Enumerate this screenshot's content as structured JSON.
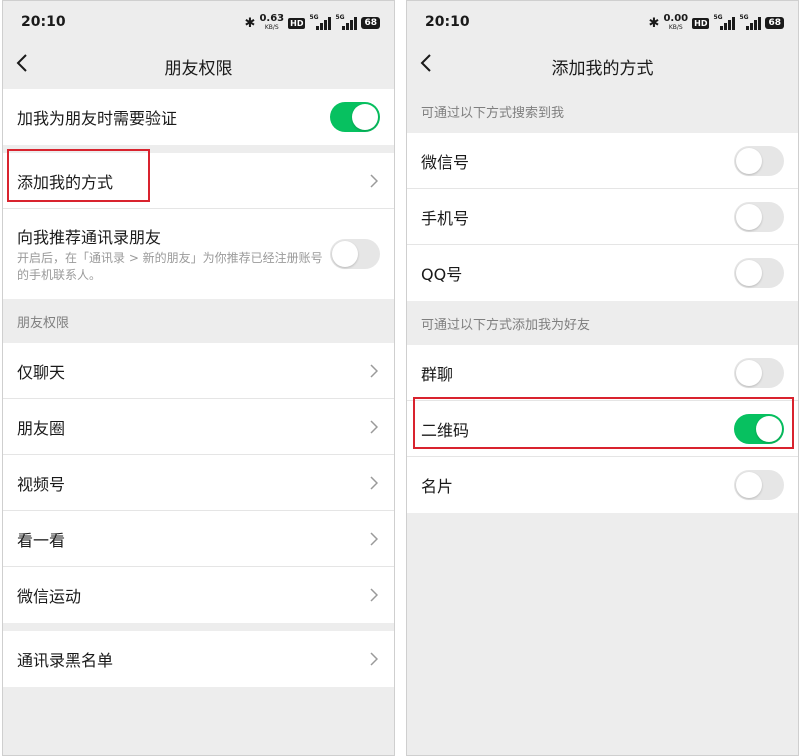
{
  "status": {
    "time": "20:10",
    "left_speed": "0.63",
    "right_speed": "0.00",
    "speed_unit": "KB/S",
    "hd": "HD",
    "net": "5G",
    "battery": "68"
  },
  "left": {
    "title": "朋友权限",
    "verify": {
      "label": "加我为朋友时需要验证",
      "on": true
    },
    "add_ways": "添加我的方式",
    "recommend": {
      "label": "向我推荐通讯录朋友",
      "desc": "开启后，在「通讯录 > 新的朋友」为你推荐已经注册账号的手机联系人。"
    },
    "section_friends": "朋友权限",
    "friend_items": [
      {
        "label": "仅聊天"
      },
      {
        "label": "朋友圈"
      },
      {
        "label": "视频号"
      },
      {
        "label": "看一看"
      },
      {
        "label": "微信运动"
      }
    ],
    "blacklist": "通讯录黑名单"
  },
  "right": {
    "title": "添加我的方式",
    "section_search": "可通过以下方式搜索到我",
    "search_items": [
      {
        "label": "微信号",
        "on": false
      },
      {
        "label": "手机号",
        "on": false
      },
      {
        "label": "QQ号",
        "on": false
      }
    ],
    "section_add": "可通过以下方式添加我为好友",
    "add_items": [
      {
        "label": "群聊",
        "on": false
      },
      {
        "label": "二维码",
        "on": true
      },
      {
        "label": "名片",
        "on": false
      }
    ]
  },
  "colors": {
    "accent_green": "#07c160",
    "highlight_red": "#d9232e",
    "background_gray": "#ededed"
  },
  "icons": [
    "back-chevron-icon",
    "chevron-right-icon",
    "bluetooth-icon",
    "signal-icon",
    "battery-icon"
  ]
}
